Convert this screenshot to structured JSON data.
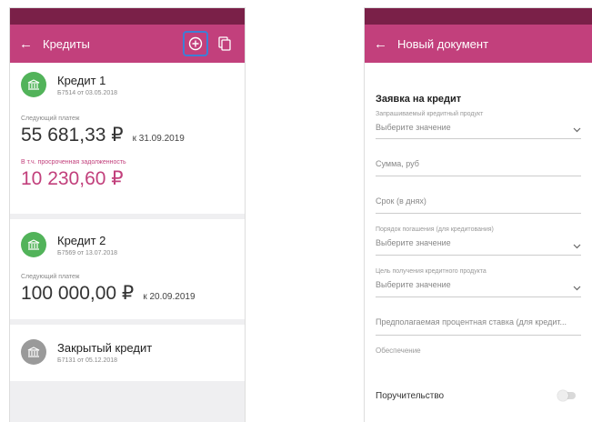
{
  "colors": {
    "brand": "#c2407c",
    "status_bar": "#7a2048",
    "loan_active": "#52b35a",
    "loan_closed": "#9a9a9a",
    "accent_highlight": "#3d7fd6"
  },
  "left_screen": {
    "title": "Кредиты",
    "back_icon": "arrow-left-icon",
    "actions": [
      "add-circle-icon",
      "document-copy-icon"
    ],
    "loans": [
      {
        "name": "Кредит 1",
        "number": "Б7514 от 03.05.2018",
        "status": "active",
        "next_payment_label": "Следующий платеж",
        "next_payment_amount": "55 681,33 ₽",
        "next_payment_date": "к 31.09.2019",
        "overdue_label": "В т.ч. просроченная задолженность",
        "overdue_amount": "10 230,60 ₽"
      },
      {
        "name": "Кредит 2",
        "number": "Б7569 от 13.07.2018",
        "status": "active",
        "next_payment_label": "Следующий платеж",
        "next_payment_amount": "100 000,00 ₽",
        "next_payment_date": "к 20.09.2019"
      },
      {
        "name": "Закрытый кредит",
        "number": "Б7131 от 05.12.2018",
        "status": "closed"
      }
    ]
  },
  "right_screen": {
    "title": "Новый документ",
    "back_icon": "arrow-left-icon",
    "form_title": "Заявка на кредит",
    "fields": [
      {
        "label": "Запрашиваемый кредитный продукт",
        "value": "Выберите значение",
        "type": "select"
      },
      {
        "placeholder": "Сумма, руб",
        "type": "input"
      },
      {
        "placeholder": "Срок (в днях)",
        "type": "input"
      },
      {
        "label": "Порядок погашения (для кредитования)",
        "value": "Выберите значение",
        "type": "select"
      },
      {
        "label": "Цель получения кредитного продукта",
        "value": "Выберите значение",
        "type": "select"
      },
      {
        "placeholder": "Предполагаемая процентная ставка (для кредит...",
        "type": "input"
      },
      {
        "placeholder": "Обеспечение",
        "type": "input"
      }
    ],
    "toggle_label": "Поручительство",
    "toggle_on": false
  }
}
